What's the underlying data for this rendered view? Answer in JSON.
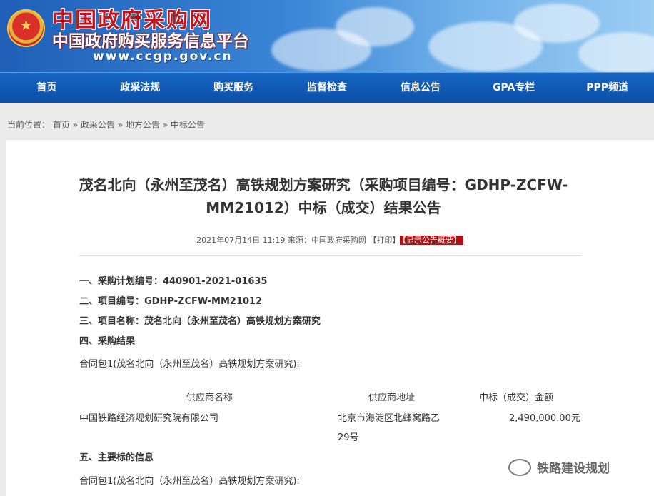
{
  "header": {
    "site_title": "中国政府采购网",
    "site_subtitle": "中国政府购买服务信息平台",
    "site_url": "www.ccgp.gov.cn"
  },
  "nav": {
    "items": [
      "首页",
      "政采法规",
      "购买服务",
      "监督检查",
      "信息公告",
      "GPA专栏",
      "PPP频道"
    ]
  },
  "breadcrumb": {
    "prefix": "当前位置：",
    "items": [
      "首页",
      "政采公告",
      "地方公告",
      "中标公告"
    ],
    "separator": "»"
  },
  "article": {
    "title_line1": "茂名北向（永州至茂名）高铁规划方案研究（采购项目编号：GDHP-ZCFW-",
    "title_line2": "MM21012）中标（成交）结果公告",
    "meta_text": "2021年07月14日 11:19 来源：中国政府采购网 【打印】",
    "meta_badge": "【显示公告概要】",
    "lines": [
      "一、采购计划编号：440901-2021-01635",
      "二、项目编号：GDHP-ZCFW-MM21012",
      "三、项目名称：茂名北向（永州至茂名）高铁规划方案研究",
      "四、采购结果",
      "合同包1(茂名北向（永州至茂名）高铁规划方案研究):"
    ],
    "table": {
      "headers": [
        "供应商名称",
        "供应商地址",
        "中标（成交）金额"
      ],
      "row": {
        "name": "中国铁路经济规划研究院有限公司",
        "address_line1": "北京市海淀区北蜂窝路乙",
        "address_line2": "29号",
        "amount": "2,490,000.00元"
      }
    },
    "section5": "五、主要标的信息",
    "package_line2": "合同包1(茂名北向（永州至茂名）高铁规划方案研究):"
  },
  "watermark": {
    "text": "铁路建设规划"
  }
}
